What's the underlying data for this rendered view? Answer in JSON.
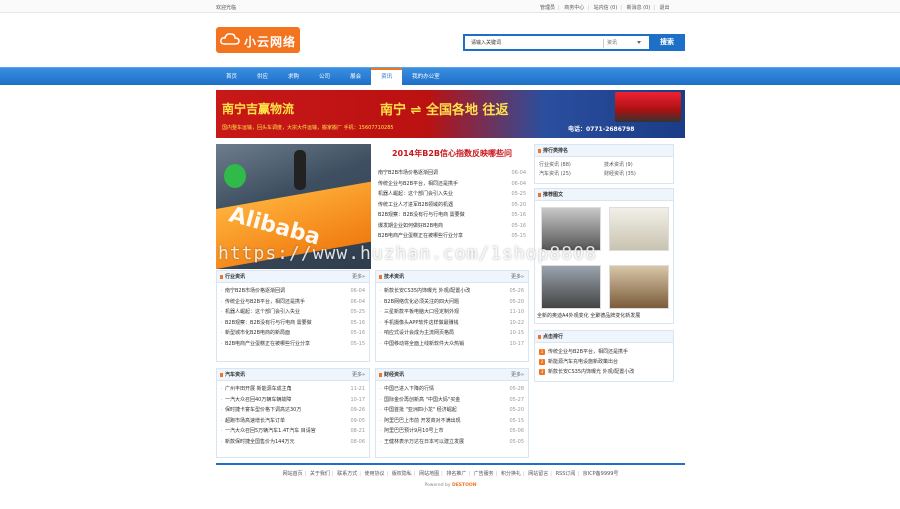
{
  "topbar": {
    "welcome": "欢迎光临",
    "links": [
      "管理员",
      "商务中心",
      "站内信 (0)",
      "新消息 (0)",
      "退出"
    ]
  },
  "logo": {
    "text": "小云网络"
  },
  "search": {
    "placeholder": "请输入关键词",
    "type": "资讯",
    "button": "搜索"
  },
  "nav": {
    "items": [
      "首页",
      "供应",
      "求购",
      "公司",
      "展会",
      "资讯",
      "我的办公室"
    ],
    "active": 5
  },
  "banner": {
    "company": "南宁吉赢物流",
    "route": "南宁 ⇌ 全国各地 往返",
    "services": "国内整车运输，回头车调度，大宗大件运输，搬家搬厂  手机：15607710285",
    "phone": "电话：0771-2686798"
  },
  "hero": {
    "word": "Alibaba"
  },
  "headline": {
    "title": "2014年B2B信心指数反映哪些问",
    "items": [
      {
        "t": "南宁B2B市场价格逐渐回调",
        "d": "06-04"
      },
      {
        "t": "传统企业与B2B平台，相同还是携手",
        "d": "06-04"
      },
      {
        "t": "机器人崛起：这个部门会引入失业",
        "d": "05-25"
      },
      {
        "t": "传统工业人才进军B2B领域的机遇",
        "d": "05-20"
      },
      {
        "t": "B2B观察：B2B没有行与行电商 需要做",
        "d": "05-16"
      },
      {
        "t": "爆发期企业如何做好B2B电商",
        "d": "05-16"
      },
      {
        "t": "B2B电商产业蛋糕正在被哪些行业分享",
        "d": "05-15"
      }
    ]
  },
  "rank": {
    "title": "排行类排名",
    "items": [
      "行业资讯 (88)",
      "技术资讯 (9)",
      "汽车资讯 (25)",
      "财经资讯 (35)"
    ]
  },
  "pics": {
    "title": "推荐图文",
    "caption": "全新的奥迪A4外观变化  全聚德品牌变化新发展"
  },
  "hits": {
    "title": "点击排行",
    "items": [
      "传统企业与B2B平台，相同还是携手",
      "新能源汽车充电设施新政策出台",
      "新款长安CS35内饰曝光 外观/配置小改"
    ]
  },
  "sections": [
    {
      "title": "行业资讯",
      "more": "更多»",
      "items": [
        {
          "t": "南宁B2B市场价格逐渐回调",
          "d": "06-04"
        },
        {
          "t": "传统企业与B2B平台，相同还是携手",
          "d": "06-04"
        },
        {
          "t": "机器人崛起：这个部门会引入失业",
          "d": "05-25"
        },
        {
          "t": "B2B观察：B2B没有行与行电商 需要做",
          "d": "05-16"
        },
        {
          "t": "新型城市化B2B电商的新局面",
          "d": "05-16"
        },
        {
          "t": "B2B电商产业蛋糕正在被哪些行业分享",
          "d": "05-15"
        },
        {
          "t": "",
          "d": ""
        }
      ]
    },
    {
      "title": "技术资讯",
      "more": "更多»",
      "items": [
        {
          "t": "新款长安CS35内饰曝光 外观/配置小改",
          "d": "05-26"
        },
        {
          "t": "B2B网络优化必须关注的四大问题",
          "d": "05-20"
        },
        {
          "t": "三星新款平板电脑大口径定制外观",
          "d": "11-10"
        },
        {
          "t": "手机摄像头APP软件这样做最赚钱",
          "d": "10-22"
        },
        {
          "t": "响应式设计会成为主流网页格局",
          "d": "10-15"
        },
        {
          "t": "中国移动将全面上线新软件大众热销",
          "d": "10-17"
        },
        {
          "t": "",
          "d": ""
        }
      ]
    },
    {
      "title": "汽车资讯",
      "more": "更多»",
      "items": [
        {
          "t": "广州丰田开展 新能源车成主角",
          "d": "11-21"
        },
        {
          "t": "一汽大众召回40万辆车辆故障",
          "d": "10-17"
        },
        {
          "t": "保时捷卡宴车型价格下调高达30万",
          "d": "09-26"
        },
        {
          "t": "超跑市场高速增长汽车订单",
          "d": "09-05"
        },
        {
          "t": "一汽大众召回5万辆汽车1.4T汽车 目请官",
          "d": "08-21"
        },
        {
          "t": "新款保时捷全国售价为144万元",
          "d": "08-06"
        },
        {
          "t": "",
          "d": ""
        }
      ]
    },
    {
      "title": "财经资讯",
      "more": "更多»",
      "items": [
        {
          "t": "中国已进入下降的行情",
          "d": "05-28"
        },
        {
          "t": "国际金价再创新高 \"中国大妈\"买金",
          "d": "05-27"
        },
        {
          "t": "中国首批 \"亚洲四小龙\" 经济崛起",
          "d": "05-20"
        },
        {
          "t": "阿里巴巴上市前 开发商对不满出现",
          "d": "05-15"
        },
        {
          "t": "阿里巴巴预计9月10号上市",
          "d": "05-06"
        },
        {
          "t": "王健林表示万达在日本可以建立发展",
          "d": "05-05"
        },
        {
          "t": "",
          "d": ""
        }
      ]
    }
  ],
  "footer": {
    "links": [
      "网站首页",
      "关于我们",
      "联系方式",
      "使用协议",
      "版权隐私",
      "网站地图",
      "排名推广",
      "广告服务",
      "积分换礼",
      "网站留言",
      "RSS订阅",
      "京ICP备9999号"
    ],
    "powered_prefix": "Powered by",
    "powered_brand": "DESTOON"
  },
  "watermark": "https://www.huzhan.com/1shop8808"
}
